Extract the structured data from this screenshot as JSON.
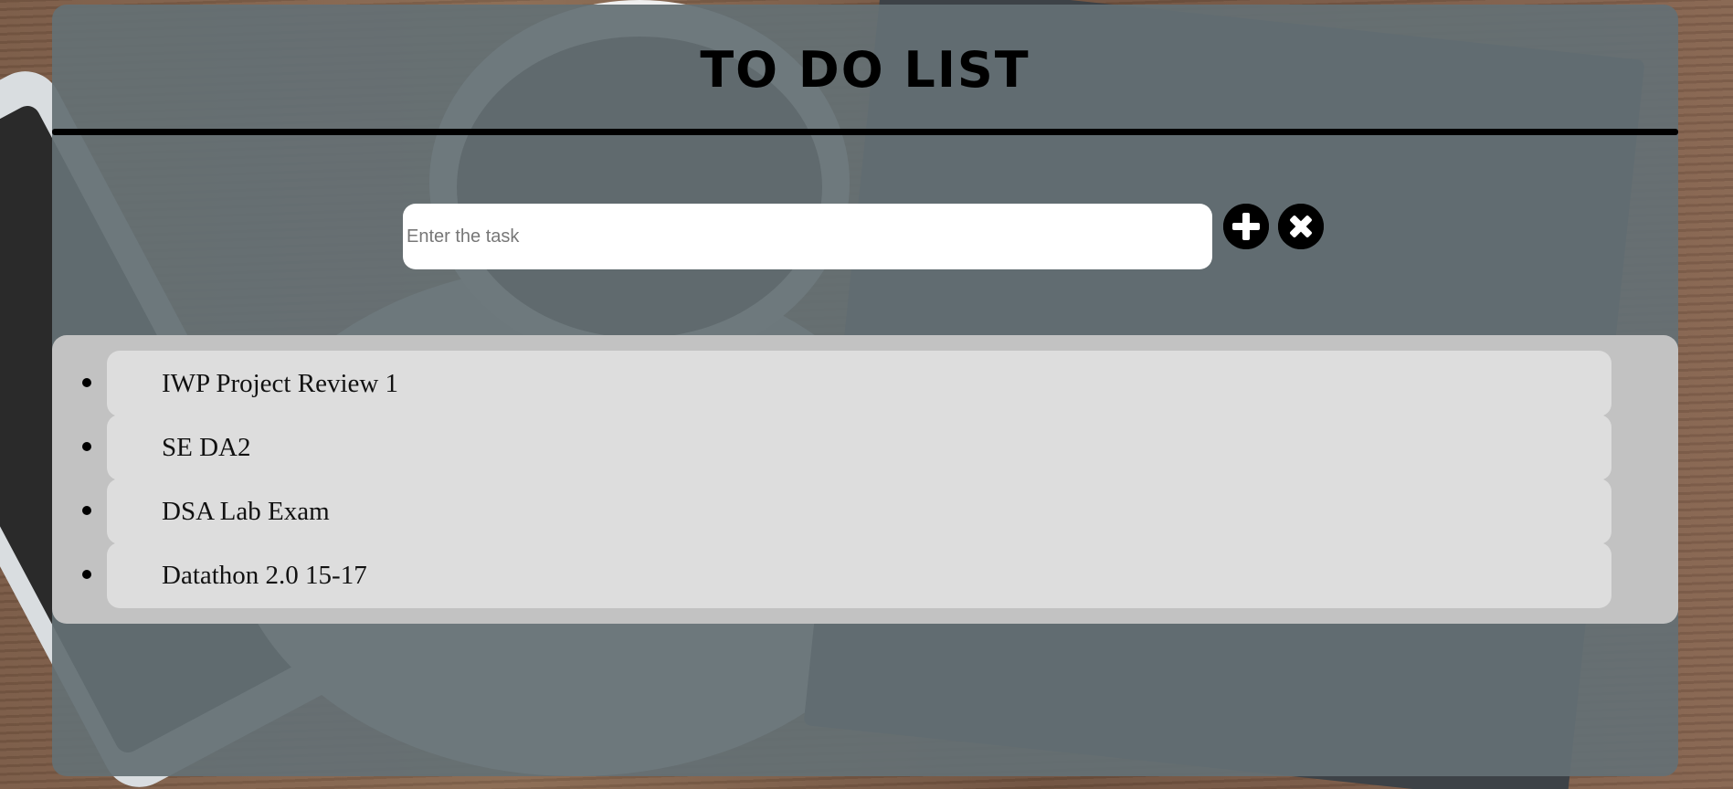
{
  "app": {
    "title": "TO DO LIST"
  },
  "input": {
    "placeholder": "Enter the task",
    "value": ""
  },
  "buttons": {
    "add_icon": "plus-circle-icon",
    "clear_icon": "x-circle-icon"
  },
  "tasks": [
    {
      "label": "IWP Project Review 1"
    },
    {
      "label": "SE DA2"
    },
    {
      "label": "DSA Lab Exam"
    },
    {
      "label": "Datathon 2.0 15-17"
    }
  ],
  "colors": {
    "panel": "#647074",
    "list_background": "#c2c2c2",
    "task_background": "#dddddd",
    "button": "#000000"
  }
}
